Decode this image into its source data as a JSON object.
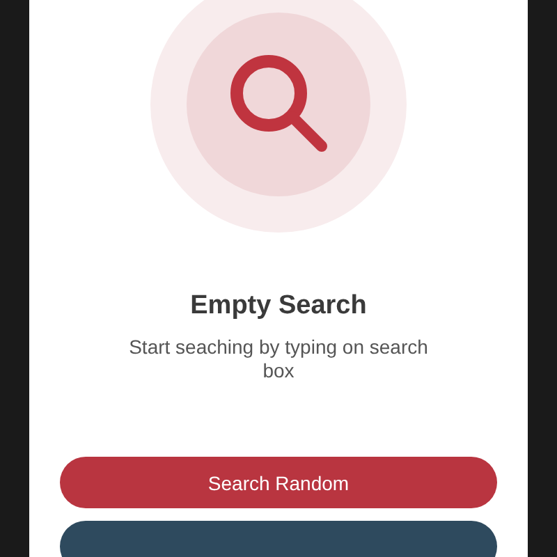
{
  "empty_state": {
    "title": "Empty Search",
    "message": "Start seaching by typing on search box"
  },
  "buttons": [
    {
      "label": "Search Random",
      "kind": "primary"
    },
    {
      "kind": "secondary"
    }
  ]
}
